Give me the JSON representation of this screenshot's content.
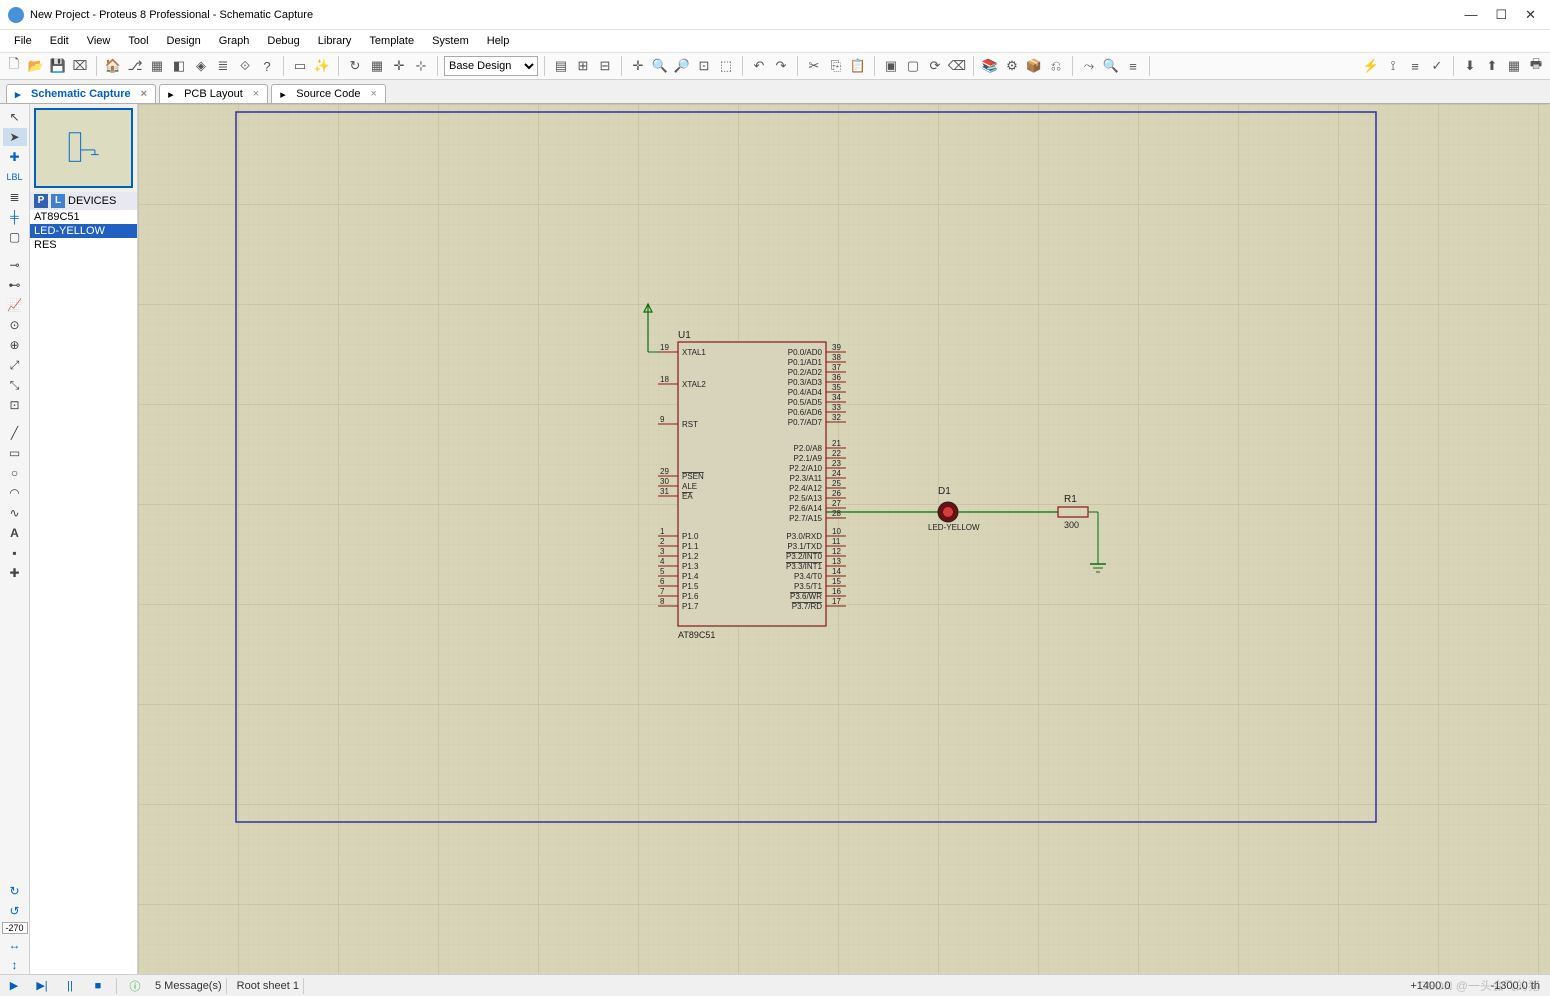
{
  "title": "New Project - Proteus 8 Professional - Schematic Capture",
  "menu": [
    "File",
    "Edit",
    "View",
    "Tool",
    "Design",
    "Graph",
    "Debug",
    "Library",
    "Template",
    "System",
    "Help"
  ],
  "toolbar_select": "Base Design",
  "tabs": [
    {
      "label": "Schematic Capture",
      "active": true
    },
    {
      "label": "PCB Layout",
      "active": false
    },
    {
      "label": "Source Code",
      "active": false
    }
  ],
  "devices_header": "DEVICES",
  "devices": [
    {
      "name": "AT89C51",
      "sel": false
    },
    {
      "name": "LED-YELLOW",
      "sel": true
    },
    {
      "name": "RES",
      "sel": false
    }
  ],
  "rot_input": "-270",
  "status": {
    "messages": "5 Message(s)",
    "sheet": "Root sheet 1",
    "coord": "+1400.0",
    "coord2": "-1300.0 th"
  },
  "watermark": "CSDN @一头会飞的猪",
  "chip": {
    "ref": "U1",
    "part": "AT89C51",
    "left_pins": [
      {
        "n": "19",
        "lbl": "XTAL1"
      },
      {
        "n": "18",
        "lbl": "XTAL2"
      },
      {
        "n": "9",
        "lbl": "RST"
      },
      {
        "n": "29",
        "lbl": "PSEN",
        "ov": true
      },
      {
        "n": "30",
        "lbl": "ALE"
      },
      {
        "n": "31",
        "lbl": "EA",
        "ov": true
      },
      {
        "n": "1",
        "lbl": "P1.0"
      },
      {
        "n": "2",
        "lbl": "P1.1"
      },
      {
        "n": "3",
        "lbl": "P1.2"
      },
      {
        "n": "4",
        "lbl": "P1.3"
      },
      {
        "n": "5",
        "lbl": "P1.4"
      },
      {
        "n": "6",
        "lbl": "P1.5"
      },
      {
        "n": "7",
        "lbl": "P1.6"
      },
      {
        "n": "8",
        "lbl": "P1.7"
      }
    ],
    "right_pins": [
      {
        "n": "39",
        "lbl": "P0.0/AD0"
      },
      {
        "n": "38",
        "lbl": "P0.1/AD1"
      },
      {
        "n": "37",
        "lbl": "P0.2/AD2"
      },
      {
        "n": "36",
        "lbl": "P0.3/AD3"
      },
      {
        "n": "35",
        "lbl": "P0.4/AD4"
      },
      {
        "n": "34",
        "lbl": "P0.5/AD5"
      },
      {
        "n": "33",
        "lbl": "P0.6/AD6"
      },
      {
        "n": "32",
        "lbl": "P0.7/AD7"
      },
      {
        "n": "21",
        "lbl": "P2.0/A8"
      },
      {
        "n": "22",
        "lbl": "P2.1/A9"
      },
      {
        "n": "23",
        "lbl": "P2.2/A10"
      },
      {
        "n": "24",
        "lbl": "P2.3/A11"
      },
      {
        "n": "25",
        "lbl": "P2.4/A12"
      },
      {
        "n": "26",
        "lbl": "P2.5/A13"
      },
      {
        "n": "27",
        "lbl": "P2.6/A14"
      },
      {
        "n": "28",
        "lbl": "P2.7/A15"
      },
      {
        "n": "10",
        "lbl": "P3.0/RXD"
      },
      {
        "n": "11",
        "lbl": "P3.1/TXD"
      },
      {
        "n": "12",
        "lbl": "P3.2/INT0",
        "ov": true
      },
      {
        "n": "13",
        "lbl": "P3.3/INT1",
        "ov": true
      },
      {
        "n": "14",
        "lbl": "P3.4/T0"
      },
      {
        "n": "15",
        "lbl": "P3.5/T1"
      },
      {
        "n": "16",
        "lbl": "P3.6/WR",
        "ov": true
      },
      {
        "n": "17",
        "lbl": "P3.7/RD",
        "ov": true
      }
    ]
  },
  "led": {
    "ref": "D1",
    "part": "LED-YELLOW"
  },
  "res": {
    "ref": "R1",
    "val": "300"
  }
}
